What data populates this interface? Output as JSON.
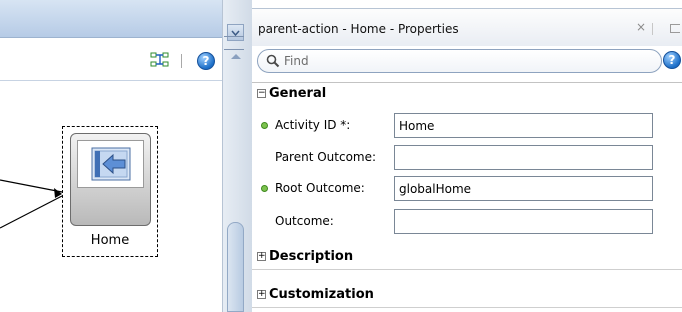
{
  "diagram": {
    "toolbar": {
      "layout_icon": "auto-layout-icon",
      "help_icon": "help-icon",
      "help_glyph": "?"
    },
    "node": {
      "label": "Home",
      "icon": "return-arrow-icon"
    }
  },
  "properties": {
    "title": "parent-action - Home - Properties",
    "close_glyph": "×",
    "search": {
      "placeholder": "Find",
      "help_glyph": "?"
    },
    "sections": {
      "general": {
        "label": "General",
        "expanded_glyph": "−",
        "fields": [
          {
            "label": "Activity ID *:",
            "value": "Home",
            "required": true
          },
          {
            "label": "Parent Outcome:",
            "value": "",
            "required": false
          },
          {
            "label": "Root Outcome:",
            "value": "globalHome",
            "required": true
          },
          {
            "label": "Outcome:",
            "value": "",
            "required": false
          }
        ]
      },
      "description": {
        "label": "Description",
        "collapsed_glyph": "+"
      },
      "customization": {
        "label": "Customization",
        "collapsed_glyph": "+"
      }
    }
  },
  "colors": {
    "accent": "#1d6fc8",
    "required_dot": "#7cc24e",
    "header_blue": "#b6cbe6"
  }
}
